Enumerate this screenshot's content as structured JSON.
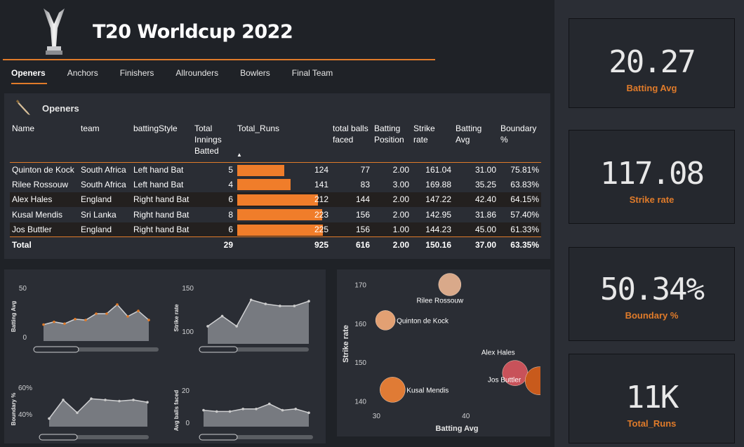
{
  "title": "T20 Worldcup 2022",
  "tabs": [
    {
      "label": "Openers",
      "active": true
    },
    {
      "label": "Anchors"
    },
    {
      "label": "Finishers"
    },
    {
      "label": "Allrounders"
    },
    {
      "label": "Bowlers"
    },
    {
      "label": "Final Team"
    }
  ],
  "section_title": "Openers",
  "table": {
    "headers": [
      "Name",
      "team",
      "battingStyle",
      "Total Innings Batted",
      "Total_Runs",
      "total balls faced",
      "Batting Position",
      "Strike rate",
      "Batting Avg",
      "Boundary %"
    ],
    "rows": [
      {
        "name": "Quinton de Kock",
        "team": "South Africa",
        "style": "Left hand Bat",
        "innings": "5",
        "runs": 124,
        "balls": "77",
        "pos": "2.00",
        "sr": "161.04",
        "avg": "31.00",
        "bnd": "75.81%"
      },
      {
        "name": "Rilee Rossouw",
        "team": "South Africa",
        "style": "Left hand Bat",
        "innings": "4",
        "runs": 141,
        "balls": "83",
        "pos": "3.00",
        "sr": "169.88",
        "avg": "35.25",
        "bnd": "63.83%"
      },
      {
        "name": "Alex Hales",
        "team": "England",
        "style": "Right hand Bat",
        "innings": "6",
        "runs": 212,
        "balls": "144",
        "pos": "2.00",
        "sr": "147.22",
        "avg": "42.40",
        "bnd": "64.15%"
      },
      {
        "name": "Kusal Mendis",
        "team": "Sri Lanka",
        "style": "Right hand Bat",
        "innings": "8",
        "runs": 223,
        "balls": "156",
        "pos": "2.00",
        "sr": "142.95",
        "avg": "31.86",
        "bnd": "57.40%"
      },
      {
        "name": "Jos Buttler",
        "team": "England",
        "style": "Right hand Bat",
        "innings": "6",
        "runs": 225,
        "balls": "156",
        "pos": "1.00",
        "sr": "144.23",
        "avg": "45.00",
        "bnd": "61.33%"
      }
    ],
    "total": {
      "label": "Total",
      "innings": "29",
      "runs": "925",
      "balls": "616",
      "pos": "2.00",
      "sr": "150.16",
      "avg": "37.00",
      "bnd": "63.35%"
    }
  },
  "kpis": [
    {
      "value": "20.27",
      "label": "Batting Avg"
    },
    {
      "value": "117.08",
      "label": "Strike rate"
    },
    {
      "value": "50.34%",
      "label": "Boundary %"
    },
    {
      "value": "11K",
      "label": "Total_Runs"
    }
  ],
  "colors": {
    "accent": "#e07b2a",
    "bar": "#f07d2a",
    "area": "#777a80"
  },
  "chart_data": [
    {
      "type": "area",
      "ylabel": "Batting Avg",
      "ytick_labels": [
        "50",
        "0"
      ],
      "ylim": [
        0,
        60
      ],
      "values": [
        18,
        21,
        19,
        24,
        23,
        30,
        30,
        40,
        27,
        33,
        23
      ],
      "highlight_color": "#e07b2a"
    },
    {
      "type": "area",
      "ylabel": "Strike rate",
      "ytick_labels": [
        "150",
        "100"
      ],
      "ylim": [
        75,
        160
      ],
      "values": [
        101,
        116,
        101,
        140,
        134,
        131,
        131,
        138
      ],
      "highlight_color": "#cccccc"
    },
    {
      "type": "area",
      "ylabel": "Boundary %",
      "ytick_labels": [
        "60%",
        "40%"
      ],
      "ylim": [
        30,
        65
      ],
      "values": [
        37,
        53,
        42,
        54,
        53,
        52,
        53,
        51
      ],
      "highlight_color": "#cccccc"
    },
    {
      "type": "area",
      "ylabel": "Avg balls faced",
      "ytick_labels": [
        "20",
        "0"
      ],
      "ylim": [
        0,
        30
      ],
      "values": [
        13,
        12,
        12,
        14,
        14,
        18,
        13,
        14,
        11
      ],
      "highlight_color": "#cccccc"
    },
    {
      "type": "scatter",
      "xlabel": "Batting Avg",
      "ylabel": "Strike rate",
      "xlim": [
        29.5,
        48.5
      ],
      "ylim": [
        137,
        171
      ],
      "xticks": [
        30,
        40
      ],
      "yticks": [
        140,
        150,
        160,
        170
      ],
      "points": [
        {
          "label": "Rilee Rossouw",
          "x": 38.2,
          "y": 170.0,
          "r": 16,
          "color": "#d9a98a"
        },
        {
          "label": "Quinton de Kock",
          "x": 31.0,
          "y": 160.8,
          "r": 14,
          "color": "#e2a073"
        },
        {
          "label": "Alex Hales",
          "x": 45.5,
          "y": 147.2,
          "r": 18,
          "color": "#c8525a"
        },
        {
          "label": "Jos Buttler",
          "x": 48.2,
          "y": 145.2,
          "r": 20,
          "color": "#c85a1c"
        },
        {
          "label": "Kusal Mendis",
          "x": 31.8,
          "y": 142.9,
          "r": 18,
          "color": "#e07b35"
        }
      ]
    }
  ]
}
